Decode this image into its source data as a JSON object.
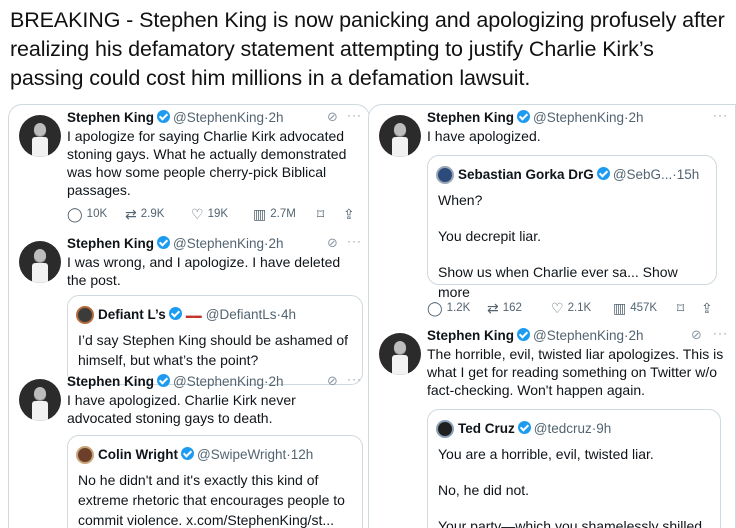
{
  "headline": "BREAKING - Stephen King is now panicking and apologizing profusely after realizing his defamatory statement attempting to justify Charlie Kirk’s passing could cost him millions in a defamation lawsuit.",
  "left": {
    "t1": {
      "name": "Stephen King",
      "handle": "@StephenKing·2h",
      "text": "I apologize for saying Charlie Kirk advocated stoning gays. What he actually demonstrated was how some people cherry-pick Biblical passages.",
      "replies": "10K",
      "retweets": "2.9K",
      "likes": "19K",
      "views": "2.7M"
    },
    "t2": {
      "name": "Stephen King",
      "handle": "@StephenKing·2h",
      "text": "I was wrong, and I apologize. I have deleted the post.",
      "quote": {
        "name": "Defiant L’s",
        "handle": "@DefiantLs·4h",
        "text": "I’d say Stephen King should be ashamed of himself, but what’s the point?"
      }
    },
    "t3": {
      "name": "Stephen King",
      "handle": "@StephenKing·2h",
      "text": "I have apologized. Charlie Kirk never advocated stoning gays to death.",
      "quote": {
        "name": "Colin Wright",
        "handle": "@SwipeWright·12h",
        "text": "No he didn't and it's exactly this kind of extreme rhetoric that encourages people to commit violence. x.com/StephenKing/st..."
      }
    }
  },
  "right": {
    "t1": {
      "name": "Stephen King",
      "handle": "@StephenKing·2h",
      "text": "I have apologized.",
      "quote": {
        "name": "Sebastian Gorka DrG",
        "handle": "@SebG...·15h",
        "line1": "When?",
        "line2": "You decrepit liar.",
        "line3": "Show us when Charlie ever sa... Show more"
      },
      "replies": "1.2K",
      "retweets": "162",
      "likes": "2.1K",
      "views": "457K"
    },
    "t2": {
      "name": "Stephen King",
      "handle": "@StephenKing·2h",
      "text": "The horrible, evil, twisted liar apologizes. This is what I get for reading something on Twitter w/o fact-checking. Won't happen again.",
      "quote": {
        "name": "Ted Cruz",
        "handle": "@tedcruz·9h",
        "line1": "You are a horrible, evil, twisted liar.",
        "line2": "No, he did not.",
        "line3": "Your party—which you shamelessly shilled..."
      }
    }
  },
  "icons": {
    "edit": "pencil-slash-icon",
    "more": "more-icon",
    "reply": "reply-icon",
    "retweet": "retweet-icon",
    "like": "like-icon",
    "views": "views-icon",
    "bookmark": "bookmark-icon",
    "share": "share-icon"
  },
  "colors": {
    "verified": "#1d9bf0",
    "secondary_text": "#536471",
    "border": "#cfd9de"
  }
}
